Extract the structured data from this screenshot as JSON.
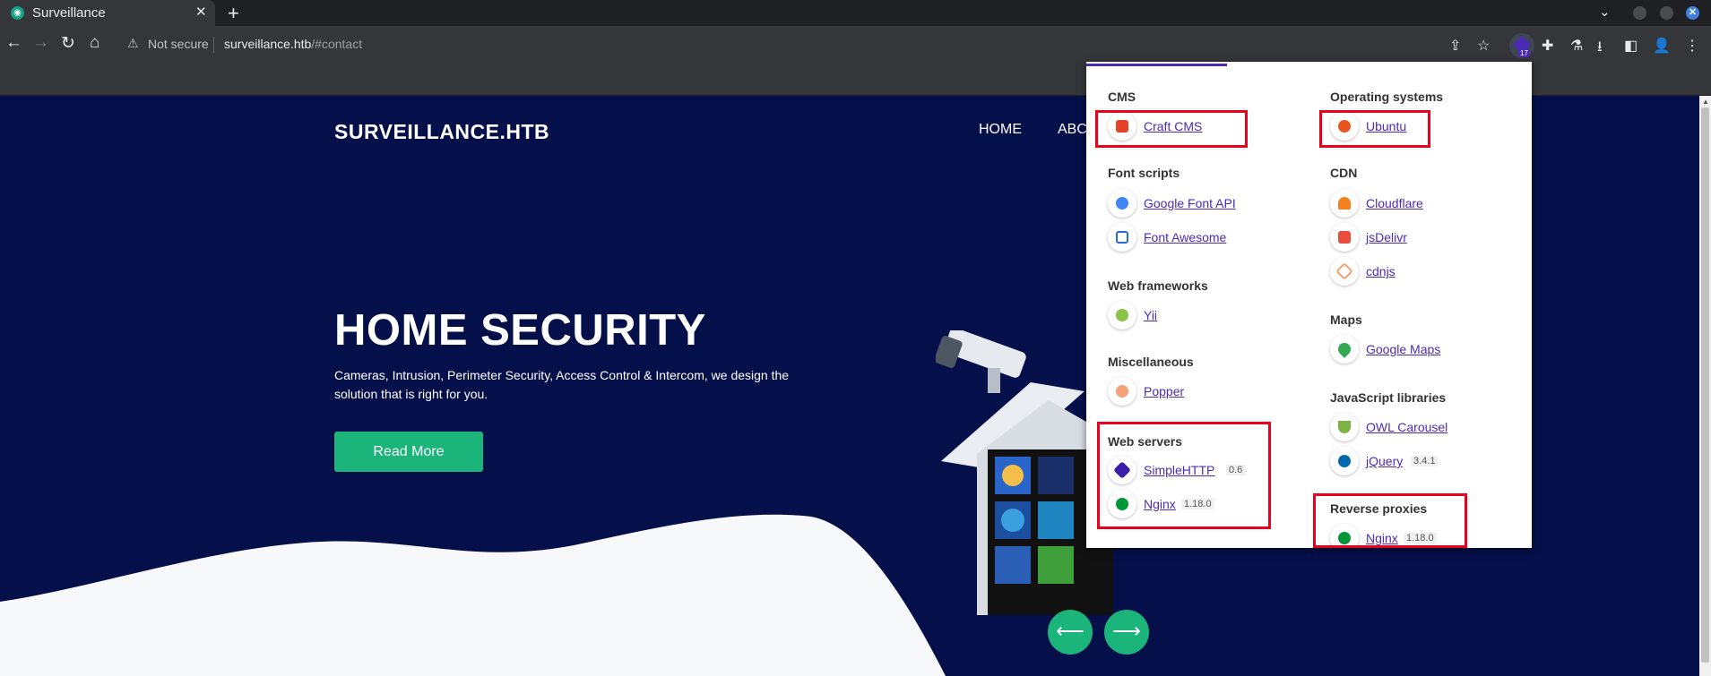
{
  "browser": {
    "tab_title": "Surveillance",
    "new_tab_label": "+",
    "not_secure_label": "Not secure",
    "url_host": "surveillance.htb",
    "url_path": "/#contact",
    "extension_badge": "17"
  },
  "site": {
    "brand": "SURVEILLANCE.HTB",
    "nav": [
      "HOME",
      "ABC"
    ],
    "hero_title": "HOME SECURITY",
    "hero_description": "Cameras, Intrusion, Perimeter Security, Access Control & Intercom, we design the solution that is right for you.",
    "read_more_label": "Read More",
    "prev_icon": "arrow-left-icon",
    "next_icon": "arrow-right-icon",
    "colors": {
      "background": "#050f4a",
      "accent": "#1bb47a"
    }
  },
  "popup": {
    "accent": "#4b2bb5",
    "left_column": [
      {
        "category": "CMS",
        "items": [
          {
            "name": "Craft CMS",
            "version": ""
          }
        ]
      },
      {
        "category": "Font scripts",
        "items": [
          {
            "name": "Google Font API",
            "version": ""
          },
          {
            "name": "Font Awesome",
            "version": ""
          }
        ]
      },
      {
        "category": "Web frameworks",
        "items": [
          {
            "name": "Yii",
            "version": ""
          }
        ]
      },
      {
        "category": "Miscellaneous",
        "items": [
          {
            "name": "Popper",
            "version": ""
          }
        ]
      },
      {
        "category": "Web servers",
        "items": [
          {
            "name": "SimpleHTTP",
            "version": "0.6"
          },
          {
            "name": "Nginx",
            "version": "1.18.0"
          }
        ]
      }
    ],
    "right_column": [
      {
        "category": "Operating systems",
        "items": [
          {
            "name": "Ubuntu",
            "version": ""
          }
        ]
      },
      {
        "category": "CDN",
        "items": [
          {
            "name": "Cloudflare",
            "version": ""
          },
          {
            "name": "jsDelivr",
            "version": ""
          },
          {
            "name": "cdnjs",
            "version": ""
          }
        ]
      },
      {
        "category": "Maps",
        "items": [
          {
            "name": "Google Maps",
            "version": ""
          }
        ]
      },
      {
        "category": "JavaScript libraries",
        "items": [
          {
            "name": "OWL Carousel",
            "version": ""
          },
          {
            "name": "jQuery",
            "version": "3.4.1"
          }
        ]
      },
      {
        "category": "Reverse proxies",
        "items": [
          {
            "name": "Nginx",
            "version": "1.18.0"
          }
        ]
      }
    ]
  }
}
